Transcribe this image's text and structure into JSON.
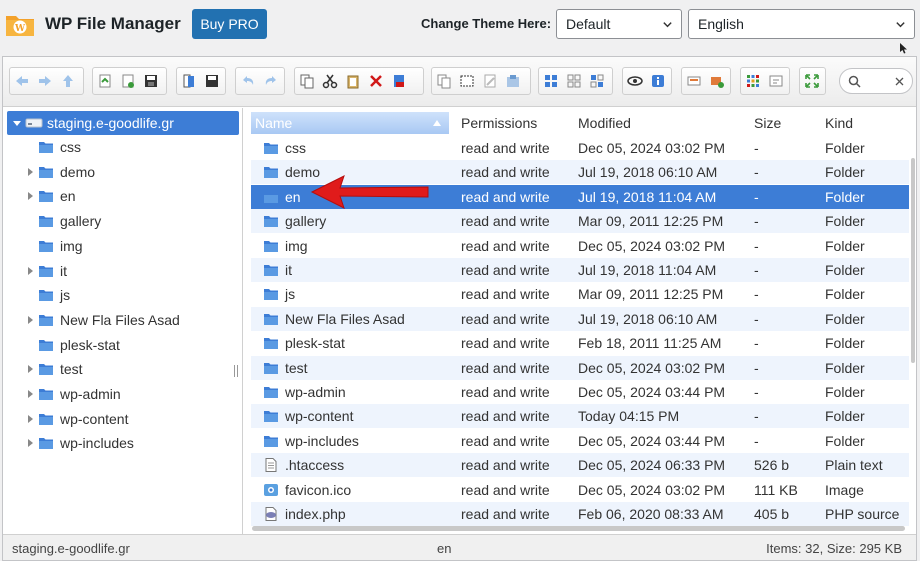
{
  "header": {
    "app_title": "WP File Manager",
    "buy_pro_label": "Buy PRO",
    "theme_label": "Change Theme Here:",
    "theme_value": "Default",
    "language_value": "English"
  },
  "search": {
    "placeholder": ""
  },
  "tree": {
    "root": "staging.e-goodlife.gr",
    "items": [
      {
        "label": "css",
        "expandable": false
      },
      {
        "label": "demo",
        "expandable": true
      },
      {
        "label": "en",
        "expandable": true
      },
      {
        "label": "gallery",
        "expandable": false
      },
      {
        "label": "img",
        "expandable": false
      },
      {
        "label": "it",
        "expandable": true
      },
      {
        "label": "js",
        "expandable": false
      },
      {
        "label": "New Fla Files Asad",
        "expandable": true
      },
      {
        "label": "plesk-stat",
        "expandable": false
      },
      {
        "label": "test",
        "expandable": true
      },
      {
        "label": "wp-admin",
        "expandable": true
      },
      {
        "label": "wp-content",
        "expandable": true
      },
      {
        "label": "wp-includes",
        "expandable": true
      }
    ]
  },
  "columns": {
    "name": "Name",
    "permissions": "Permissions",
    "modified": "Modified",
    "size": "Size",
    "kind": "Kind"
  },
  "files": [
    {
      "name": "css",
      "perm": "read and write",
      "modified": "Dec 05, 2024 03:02 PM",
      "size": "-",
      "kind": "Folder",
      "icon": "folder"
    },
    {
      "name": "demo",
      "perm": "read and write",
      "modified": "Jul 19, 2018 06:10 AM",
      "size": "-",
      "kind": "Folder",
      "icon": "folder"
    },
    {
      "name": "en",
      "perm": "read and write",
      "modified": "Jul 19, 2018 11:04 AM",
      "size": "-",
      "kind": "Folder",
      "icon": "folder",
      "selected": true
    },
    {
      "name": "gallery",
      "perm": "read and write",
      "modified": "Mar 09, 2011 12:25 PM",
      "size": "-",
      "kind": "Folder",
      "icon": "folder"
    },
    {
      "name": "img",
      "perm": "read and write",
      "modified": "Dec 05, 2024 03:02 PM",
      "size": "-",
      "kind": "Folder",
      "icon": "folder"
    },
    {
      "name": "it",
      "perm": "read and write",
      "modified": "Jul 19, 2018 11:04 AM",
      "size": "-",
      "kind": "Folder",
      "icon": "folder"
    },
    {
      "name": "js",
      "perm": "read and write",
      "modified": "Mar 09, 2011 12:25 PM",
      "size": "-",
      "kind": "Folder",
      "icon": "folder"
    },
    {
      "name": "New Fla Files Asad",
      "perm": "read and write",
      "modified": "Jul 19, 2018 06:10 AM",
      "size": "-",
      "kind": "Folder",
      "icon": "folder"
    },
    {
      "name": "plesk-stat",
      "perm": "read and write",
      "modified": "Feb 18, 2011 11:25 AM",
      "size": "-",
      "kind": "Folder",
      "icon": "folder"
    },
    {
      "name": "test",
      "perm": "read and write",
      "modified": "Dec 05, 2024 03:02 PM",
      "size": "-",
      "kind": "Folder",
      "icon": "folder"
    },
    {
      "name": "wp-admin",
      "perm": "read and write",
      "modified": "Dec 05, 2024 03:44 PM",
      "size": "-",
      "kind": "Folder",
      "icon": "folder"
    },
    {
      "name": "wp-content",
      "perm": "read and write",
      "modified": "Today 04:15 PM",
      "size": "-",
      "kind": "Folder",
      "icon": "folder"
    },
    {
      "name": "wp-includes",
      "perm": "read and write",
      "modified": "Dec 05, 2024 03:44 PM",
      "size": "-",
      "kind": "Folder",
      "icon": "folder"
    },
    {
      "name": ".htaccess",
      "perm": "read and write",
      "modified": "Dec 05, 2024 06:33 PM",
      "size": "526 b",
      "kind": "Plain text",
      "icon": "text-file"
    },
    {
      "name": "favicon.ico",
      "perm": "read and write",
      "modified": "Dec 05, 2024 03:02 PM",
      "size": "111 KB",
      "kind": "Image",
      "icon": "image-file"
    },
    {
      "name": "index.php",
      "perm": "read and write",
      "modified": "Feb 06, 2020 08:33 AM",
      "size": "405 b",
      "kind": "PHP source",
      "icon": "php-file"
    }
  ],
  "status": {
    "path": "staging.e-goodlife.gr",
    "selected": "en",
    "summary": "Items: 32, Size: 295 KB"
  },
  "colors": {
    "accent": "#2271b1",
    "selection": "#3d7dd6",
    "folder": "#4a8ad8",
    "annotation_arrow": "#e01b1b"
  }
}
